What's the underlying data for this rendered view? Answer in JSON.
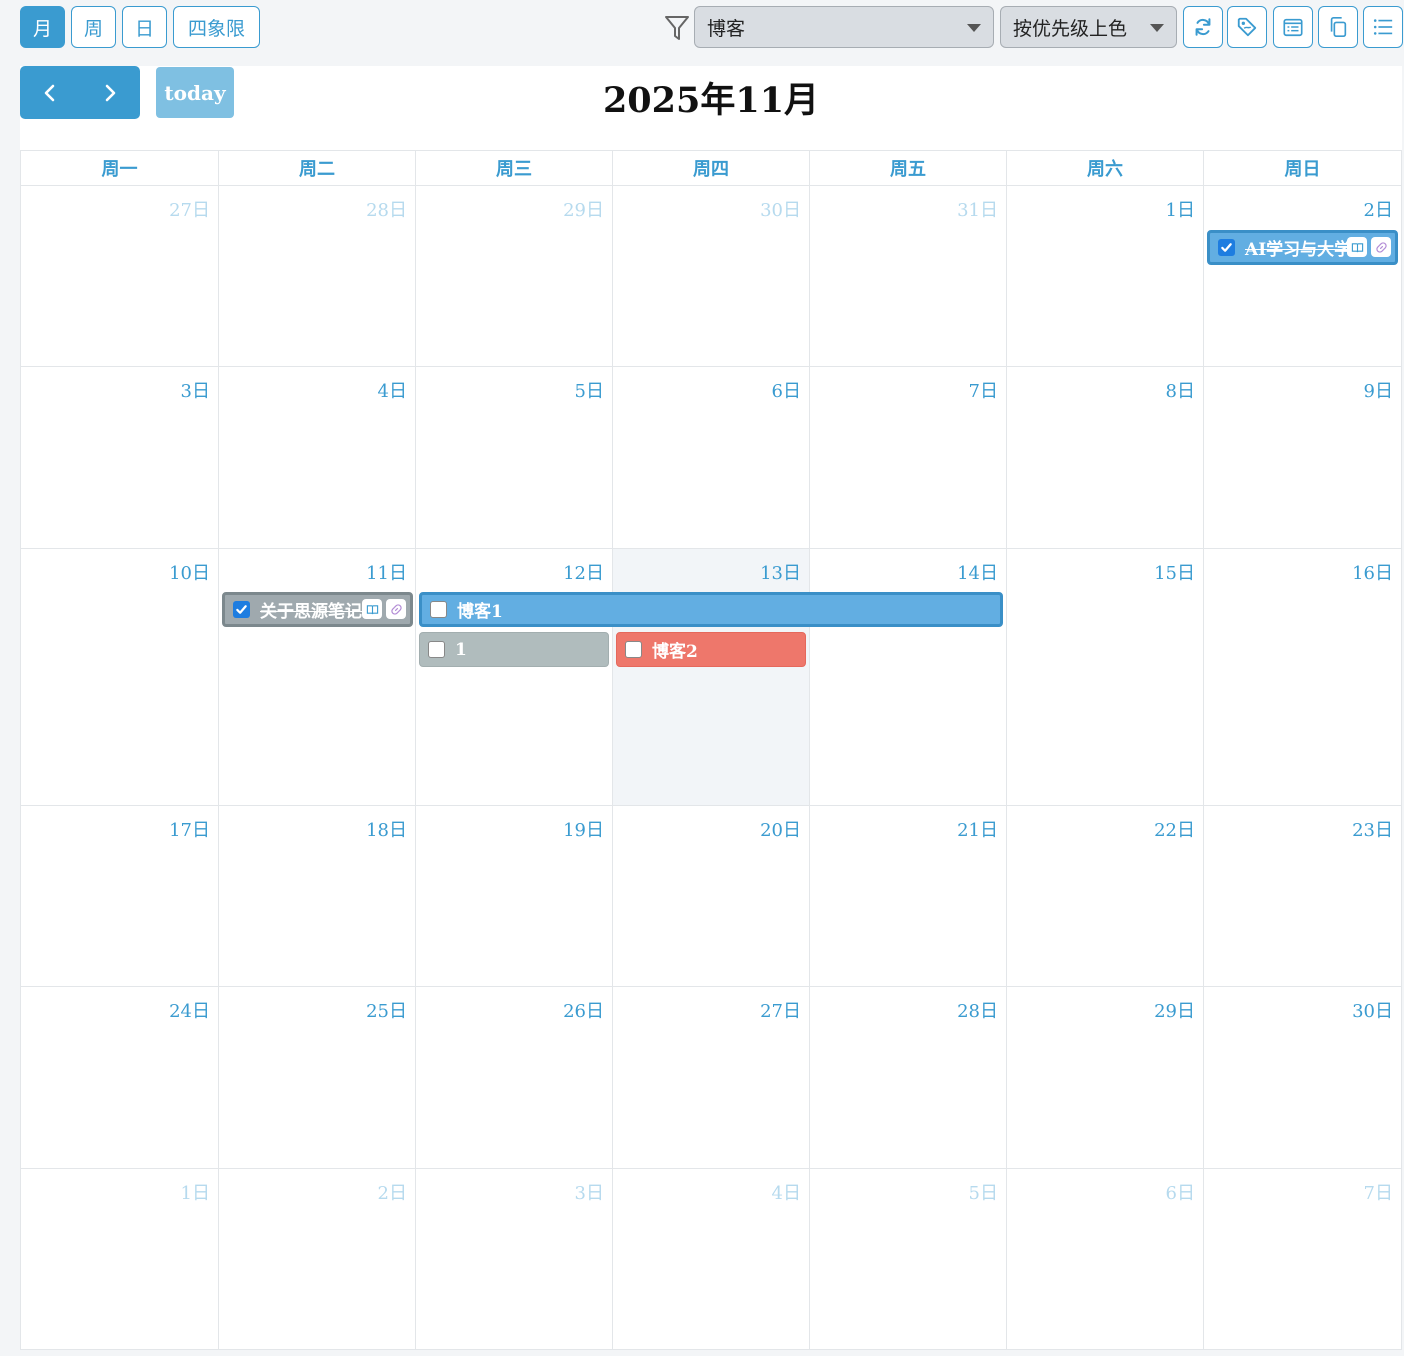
{
  "toolbar": {
    "views": [
      {
        "label": "月",
        "active": true
      },
      {
        "label": "周",
        "active": false
      },
      {
        "label": "日",
        "active": false
      },
      {
        "label": "四象限",
        "active": false
      }
    ],
    "filter_value": "博客",
    "color_mode": "按优先级上色",
    "icons": [
      "refresh-icon",
      "tag-icon",
      "calendar-list-icon",
      "copy-icon",
      "list-icon"
    ]
  },
  "header": {
    "today_label": "today",
    "title": "2025年11月"
  },
  "weekdays": [
    "周一",
    "周二",
    "周三",
    "周四",
    "周五",
    "周六",
    "周日"
  ],
  "weeks": [
    [
      "27日",
      "28日",
      "29日",
      "30日",
      "31日",
      "1日",
      "2日"
    ],
    [
      "3日",
      "4日",
      "5日",
      "6日",
      "7日",
      "8日",
      "9日"
    ],
    [
      "10日",
      "11日",
      "12日",
      "13日",
      "14日",
      "15日",
      "16日"
    ],
    [
      "17日",
      "18日",
      "19日",
      "20日",
      "21日",
      "22日",
      "23日"
    ],
    [
      "24日",
      "25日",
      "26日",
      "27日",
      "28日",
      "29日",
      "30日"
    ],
    [
      "1日",
      "2日",
      "3日",
      "4日",
      "5日",
      "6日",
      "7日"
    ]
  ],
  "events": {
    "ai_learning": {
      "title": "AI学习与大学",
      "done": true,
      "color": "#62aee2"
    },
    "siyuan_notes": {
      "title": "关于思源笔记",
      "done": true,
      "color": "#9fa9ae"
    },
    "blog1": {
      "title": "博客1",
      "done": false,
      "color": "#62aee2"
    },
    "task_1": {
      "title": "1",
      "done": false,
      "color": "#b0bcbd"
    },
    "blog2": {
      "title": "博客2",
      "done": false,
      "color": "#ee776b"
    }
  },
  "colors": {
    "accent": "#3a9bd0",
    "today_bg": "#f2f5f8",
    "other_month_text": "#b6daee"
  }
}
